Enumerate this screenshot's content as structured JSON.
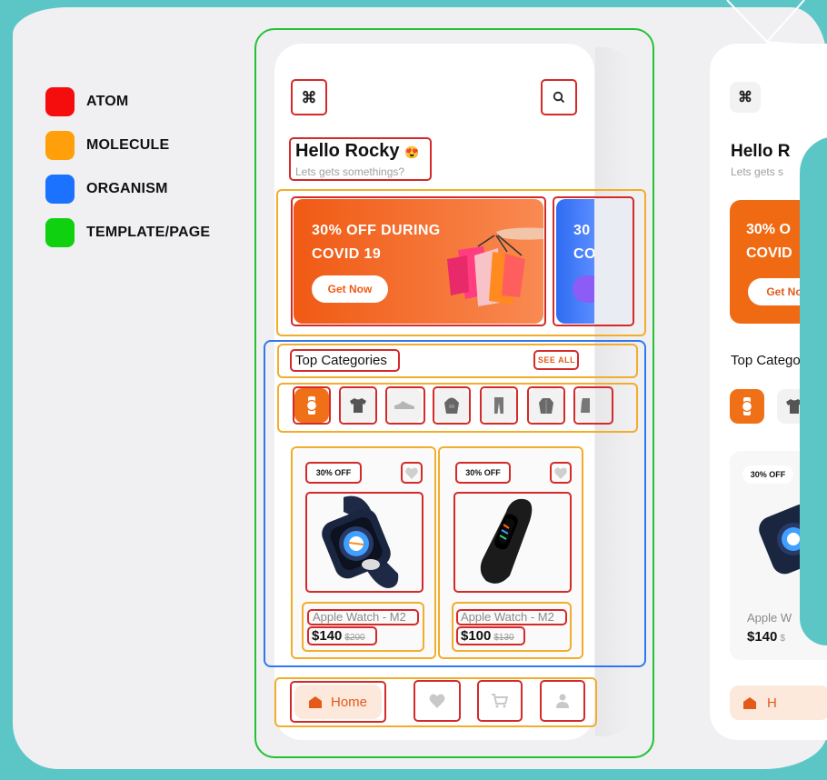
{
  "legend": [
    {
      "label": "ATOM",
      "color": "#f50d0d"
    },
    {
      "label": "MOLECULE",
      "color": "#ff9f0a"
    },
    {
      "label": "ORGANISM",
      "color": "#1a72ff"
    },
    {
      "label": "TEMPLATE/PAGE",
      "color": "#0fd10f"
    }
  ],
  "header": {
    "menu_icon": "command-icon",
    "search_icon": "search-icon",
    "greeting": "Hello Rocky",
    "greeting_emoji": "😍",
    "subtitle": "Lets gets somethings?"
  },
  "banners": [
    {
      "title_line1": "30% OFF DURING",
      "title_line2": "COVID 19",
      "button": "Get Now",
      "color": "#f05a14"
    },
    {
      "title_line1": "30",
      "title_line2": "CO",
      "color": "#2e6cf2"
    }
  ],
  "categories": {
    "title": "Top Categories",
    "see_all": "SEE ALL",
    "items": [
      "watch-icon",
      "tshirt-icon",
      "shoe-icon",
      "hoodie-icon",
      "pants-icon",
      "jacket-icon",
      "coat-icon"
    ],
    "active_index": 0
  },
  "products": [
    {
      "badge": "30% OFF",
      "name": "Apple Watch  - M2",
      "price": "$140",
      "old_price": "$200"
    },
    {
      "badge": "30% OFF",
      "name": "Apple Watch  - M2",
      "price": "$100",
      "old_price": "$130"
    }
  ],
  "bottom_nav": {
    "home_label": "Home",
    "items": [
      "home-icon",
      "heart-icon",
      "cart-icon",
      "profile-icon"
    ]
  },
  "preview": {
    "greeting": "Hello R",
    "subtitle": "Lets gets s",
    "banner_line1": "30% O",
    "banner_line2": "COVID",
    "button": "Get No",
    "categories_title": "Top Catego",
    "badge": "30% OFF",
    "product_name": "Apple W",
    "price": "$140",
    "old_price": "$",
    "home_label": "H"
  }
}
